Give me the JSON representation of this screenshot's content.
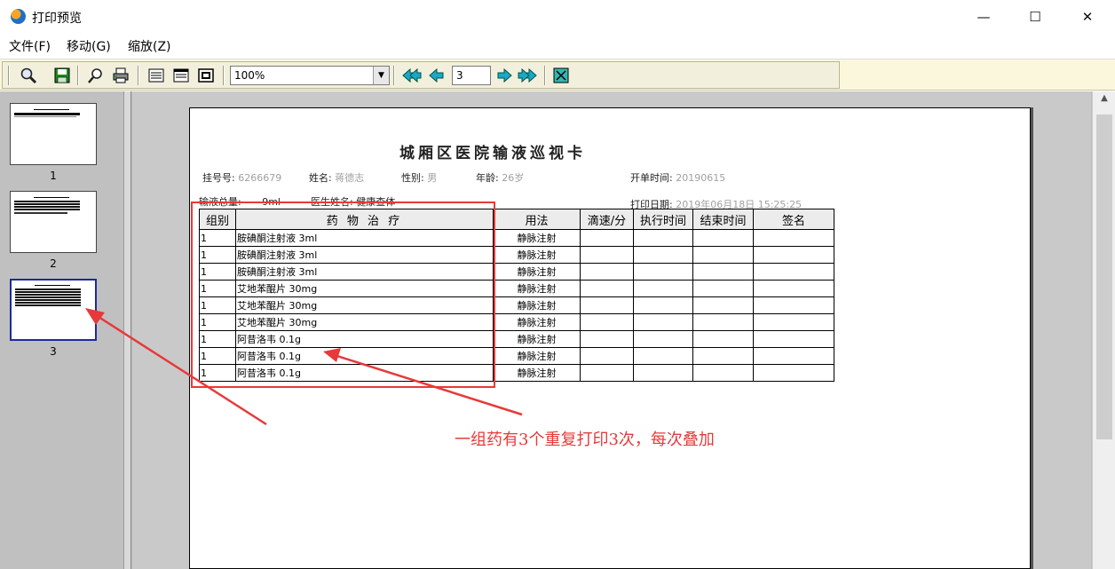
{
  "window": {
    "title": "打印预览",
    "controls": {
      "minimize": "—",
      "maximize": "☐",
      "close": "✕"
    }
  },
  "menu": [
    "文件(F)",
    "移动(G)",
    "缩放(Z)"
  ],
  "toolbar": {
    "zoom_value": "100%",
    "page_value": "3",
    "icons": [
      "zoom-icon",
      "save-icon",
      "find-icon",
      "print-icon",
      "single-page-icon",
      "page-setup-icon",
      "multi-page-icon",
      "first-page-icon",
      "prev-page-icon",
      "next-page-icon",
      "last-page-icon",
      "close-preview-icon"
    ]
  },
  "thumbnails": [
    {
      "num": "1"
    },
    {
      "num": "2"
    },
    {
      "num": "3"
    }
  ],
  "document": {
    "title": "城厢区医院输液巡视卡",
    "reg_no_label": "挂号号:",
    "reg_no": "6266679",
    "name_label": "姓名:",
    "name": "蒋德志",
    "gender_label": "性别:",
    "gender": "男",
    "age_label": "年龄:",
    "age": "26岁",
    "order_time_label": "开单时间:",
    "order_time": "20190615",
    "infusion_total_label": "输液总量:",
    "infusion_total": "9ml",
    "doctor_label": "医生姓名:",
    "doctor": "健康查体",
    "print_date_label": "打印日期:",
    "print_date": "2019年06月18日  15:25:25",
    "columns": [
      "组别",
      "药 物 治 疗",
      "用法",
      "滴速/分",
      "执行时间",
      "结束时间",
      "签名"
    ],
    "rows": [
      {
        "group": "1",
        "drug": "胺碘酮注射液 3ml",
        "usage": "静脉注射"
      },
      {
        "group": "1",
        "drug": "胺碘酮注射液 3ml",
        "usage": "静脉注射"
      },
      {
        "group": "1",
        "drug": "胺碘酮注射液 3ml",
        "usage": "静脉注射"
      },
      {
        "group": "1",
        "drug": "艾地苯醌片 30mg",
        "usage": "静脉注射"
      },
      {
        "group": "1",
        "drug": "艾地苯醌片 30mg",
        "usage": "静脉注射"
      },
      {
        "group": "1",
        "drug": "艾地苯醌片 30mg",
        "usage": "静脉注射"
      },
      {
        "group": "1",
        "drug": "阿昔洛韦 0.1g",
        "usage": "静脉注射"
      },
      {
        "group": "1",
        "drug": "阿昔洛韦 0.1g",
        "usage": "静脉注射"
      },
      {
        "group": "1",
        "drug": "阿昔洛韦 0.1g",
        "usage": "静脉注射"
      }
    ]
  },
  "annotation": {
    "text": "一组药有3个重复打印3次，每次叠加",
    "color": "#e8393a"
  }
}
